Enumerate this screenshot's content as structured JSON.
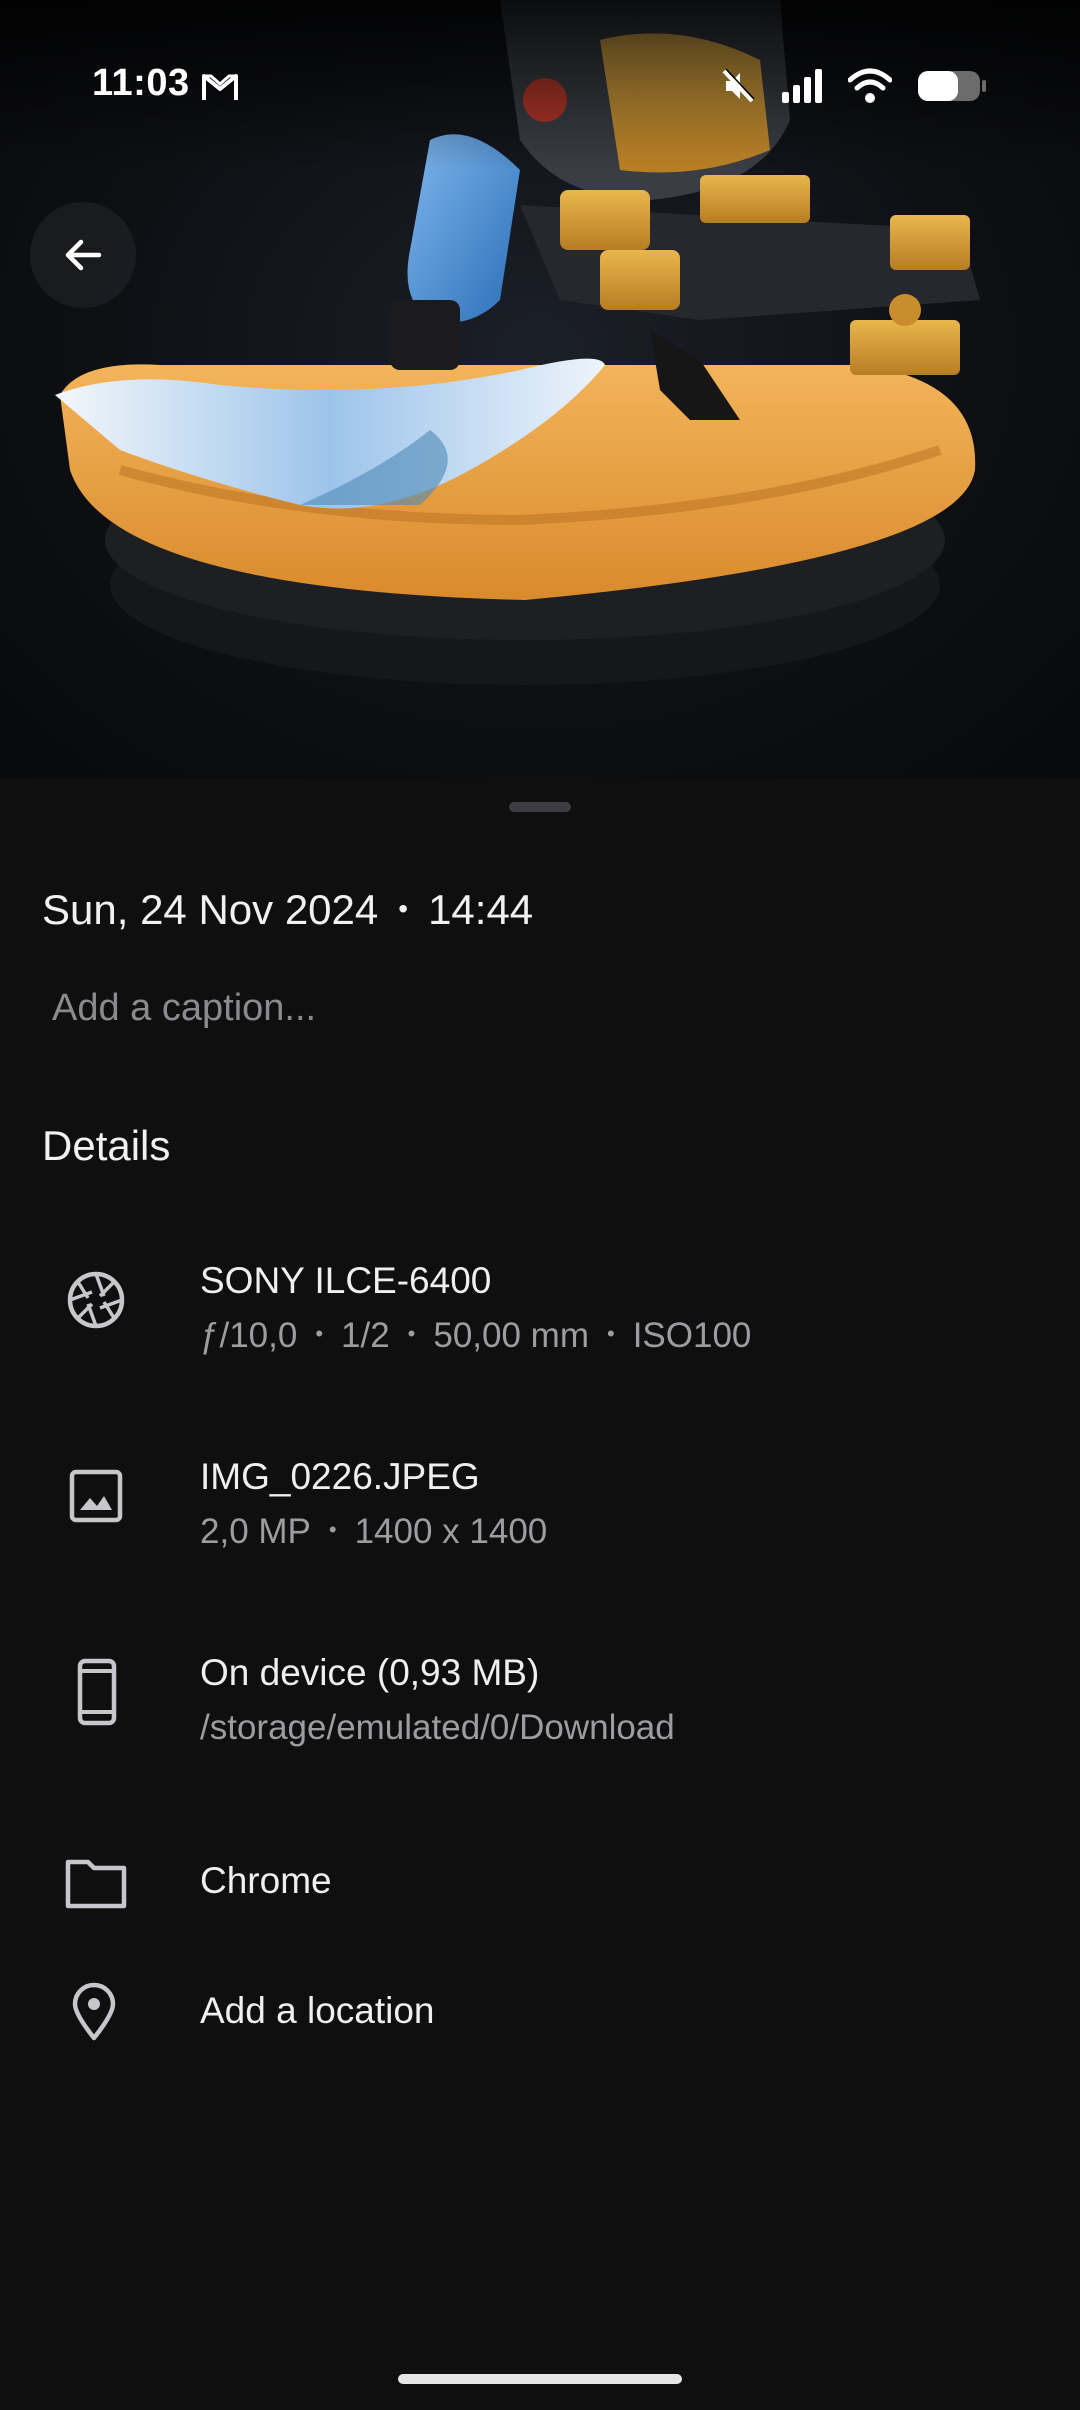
{
  "status_bar": {
    "time": "11:03",
    "notification_icon": "gmail-icon",
    "icons": [
      "mute-icon",
      "signal-icon",
      "wifi-icon",
      "battery-icon"
    ]
  },
  "header": {
    "back_icon": "arrow-back-icon"
  },
  "photo": {
    "description_icon": "photo-image"
  },
  "sheet": {
    "date": "Sun, 24 Nov 2024",
    "separator": "•",
    "time": "14:44",
    "caption_placeholder": "Add a caption...",
    "details_title": "Details",
    "camera": {
      "icon": "aperture-icon",
      "title": "SONY ILCE-6400",
      "aperture": "ƒ/10,0",
      "shutter": "1/2",
      "focal_length": "50,00 mm",
      "iso": "ISO100"
    },
    "file": {
      "icon": "image-icon",
      "title": "IMG_0226.JPEG",
      "megapixels": "2,0 MP",
      "dimensions": "1400 x 1400"
    },
    "storage": {
      "icon": "phone-icon",
      "title": "On device (0,93 MB)",
      "path": "/storage/emulated/0/Download"
    },
    "folder": {
      "icon": "folder-icon",
      "title": "Chrome"
    },
    "location": {
      "icon": "location-pin-icon",
      "title": "Add a location"
    }
  },
  "colors": {
    "background": "#0f0f10",
    "primary_text": "#efeff0",
    "secondary_text": "#9c9da1"
  }
}
